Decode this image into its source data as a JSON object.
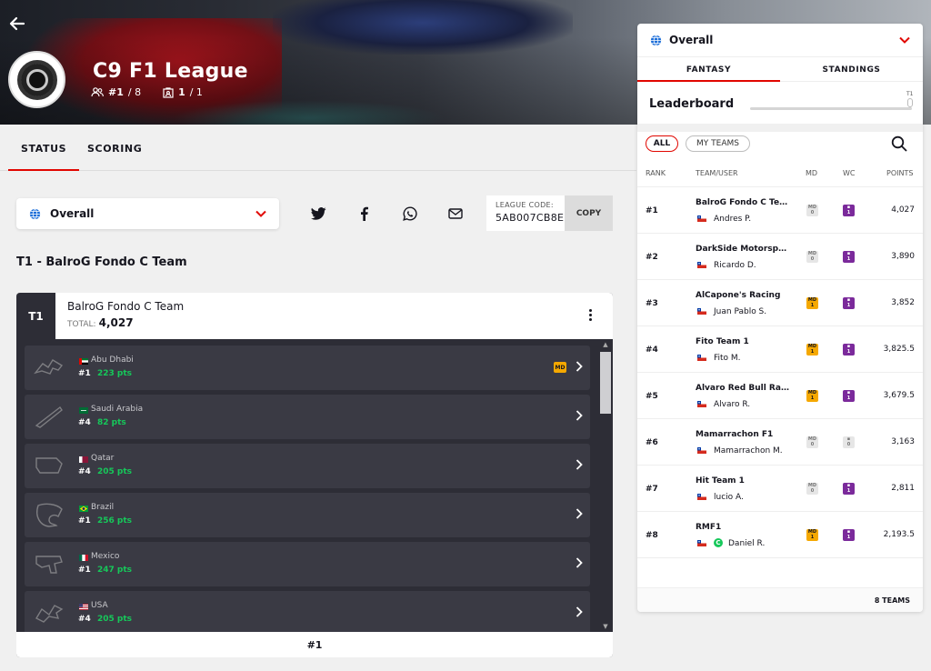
{
  "hero": {
    "title": "C9 F1 League",
    "rank_value": "#1",
    "rank_total": "/ 8",
    "teams_value": "1",
    "teams_total": "/ 1"
  },
  "tabs": [
    {
      "label": "STATUS",
      "active": true
    },
    {
      "label": "SCORING",
      "active": false
    }
  ],
  "selector": {
    "label": "Overall"
  },
  "league_code": {
    "label": "LEAGUE CODE:",
    "value": "5AB007CB8E",
    "copy_label": "COPY"
  },
  "section_title": "T1 - BalroG Fondo C Team",
  "team": {
    "rank_tag": "T1",
    "name": "BalroG Fondo C Team",
    "total_label": "TOTAL:",
    "total_value": "4,027",
    "footer": "#1",
    "races": [
      {
        "name": "Abu Dhabi",
        "pos": "#1",
        "pts": "223 pts",
        "md": true,
        "md_label": "MD"
      },
      {
        "name": "Saudi Arabia",
        "pos": "#4",
        "pts": "82 pts",
        "md": false
      },
      {
        "name": "Qatar",
        "pos": "#4",
        "pts": "205 pts",
        "md": false
      },
      {
        "name": "Brazil",
        "pos": "#1",
        "pts": "256 pts",
        "md": false
      },
      {
        "name": "Mexico",
        "pos": "#1",
        "pts": "247 pts",
        "md": false
      },
      {
        "name": "USA",
        "pos": "#4",
        "pts": "205 pts",
        "md": false
      }
    ]
  },
  "panel": {
    "selector_label": "Overall",
    "tabs": [
      {
        "label": "FANTASY",
        "active": true
      },
      {
        "label": "STANDINGS",
        "active": false
      }
    ],
    "leaderboard_title": "Leaderboard",
    "leaderboard_marker": "T1",
    "chips": {
      "all": "ALL",
      "mine": "MY TEAMS"
    },
    "columns": {
      "rank": "RANK",
      "team": "TEAM/USER",
      "md": "MD",
      "wc": "WC",
      "points": "POINTS"
    },
    "rows": [
      {
        "rank": "#1",
        "team": "BalroG Fondo C Team",
        "user": "Andres P.",
        "md": false,
        "md_label": "MD",
        "md_count": "0",
        "wc": true,
        "wc_count": "1",
        "points": "4,027",
        "extra_badge": ""
      },
      {
        "rank": "#2",
        "team": "DarkSide Motorsport",
        "user": "Ricardo D.",
        "md": false,
        "md_label": "MD",
        "md_count": "0",
        "wc": true,
        "wc_count": "1",
        "points": "3,890",
        "extra_badge": ""
      },
      {
        "rank": "#3",
        "team": "AlCapone's Racing",
        "user": "Juan Pablo S.",
        "md": true,
        "md_label": "MD",
        "md_count": "1",
        "wc": true,
        "wc_count": "1",
        "points": "3,852",
        "extra_badge": ""
      },
      {
        "rank": "#4",
        "team": "Fito Team 1",
        "user": "Fito M.",
        "md": true,
        "md_label": "MD",
        "md_count": "1",
        "wc": true,
        "wc_count": "1",
        "points": "3,825.5",
        "extra_badge": ""
      },
      {
        "rank": "#5",
        "team": "Alvaro Red Bull Racing",
        "user": "Alvaro R.",
        "md": true,
        "md_label": "MD",
        "md_count": "1",
        "wc": true,
        "wc_count": "1",
        "points": "3,679.5",
        "extra_badge": ""
      },
      {
        "rank": "#6",
        "team": "Mamarrachon F1",
        "user": "Mamarrachon M.",
        "md": false,
        "md_label": "MD",
        "md_count": "0",
        "wc": false,
        "wc_count": "0",
        "points": "3,163",
        "extra_badge": ""
      },
      {
        "rank": "#7",
        "team": "Hit Team 1",
        "user": "lucio A.",
        "md": false,
        "md_label": "MD",
        "md_count": "0",
        "wc": true,
        "wc_count": "1",
        "points": "2,811",
        "extra_badge": ""
      },
      {
        "rank": "#8",
        "team": "RMF1",
        "user": "Daniel R.",
        "md": true,
        "md_label": "MD",
        "md_count": "1",
        "wc": true,
        "wc_count": "1",
        "points": "2,193.5",
        "extra_badge": "C"
      }
    ],
    "footer": "8 TEAMS"
  },
  "colors": {
    "accent": "#e10600",
    "points_green": "#16c85a",
    "md_gold": "#f5a800",
    "wc_purple": "#7b2a9b",
    "card_dark": "#2d2d36"
  }
}
